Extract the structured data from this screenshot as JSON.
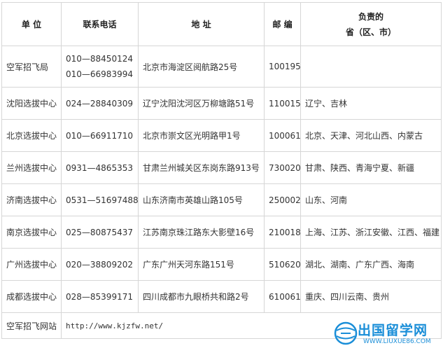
{
  "table": {
    "headers": [
      "单 位",
      "联系电话",
      "地 址",
      "邮 编"
    ],
    "header_region_line1": "负责的",
    "header_region_line2": "省（区、市）",
    "rows": [
      {
        "unit": "空军招飞局",
        "phone1": "010—88450124",
        "phone2": "010—66983994",
        "address": "北京市海淀区阅航路25号",
        "postcode": "100195",
        "regions": ""
      },
      {
        "unit": "沈阳选拔中心",
        "phone1": "024—28840309",
        "address": "辽宁沈阳沈河区万柳塘路51号",
        "postcode": "110015",
        "regions": "辽宁、吉林"
      },
      {
        "unit": "北京选拔中心",
        "phone1": "010—66911710",
        "address": "北京市崇文区光明路甲1号",
        "postcode": "100061",
        "regions": "北京、天津、河北山西、内蒙古"
      },
      {
        "unit": "兰州选拔中心",
        "phone1": "0931—4865353",
        "address": "甘肃兰州城关区东岗东路913号",
        "postcode": "730020",
        "regions": "甘肃、陕西、青海宁夏、新疆"
      },
      {
        "unit": "济南选拔中心",
        "phone1": "0531—51697488",
        "address": "山东济南市英雄山路105号",
        "postcode": "250002",
        "regions": "山东、河南"
      },
      {
        "unit": "南京选拔中心",
        "phone1": "025—80875437",
        "address": "江苏南京珠江路东大影壁16号",
        "postcode": "210018",
        "regions": "上海、江苏、浙江安徽、江西、福建"
      },
      {
        "unit": "广州选拔中心",
        "phone1": "020—38809202",
        "address": "广东广州天河东路151号",
        "postcode": "510620",
        "regions": "湖北、湖南、广东广西、海南"
      },
      {
        "unit": "成都选拔中心",
        "phone1": "028—85399171",
        "address": "四川成都市九眼桥共和路2号",
        "postcode": "610061",
        "regions": "重庆、四川云南、贵州"
      }
    ],
    "website_label": "空军招飞网站",
    "website_url": "http://www.kjzfw.net/"
  },
  "watermark": {
    "text": "出国留学网",
    "url": "WWW.LIUXUE86.COM",
    "color": "#1a8ed8"
  }
}
